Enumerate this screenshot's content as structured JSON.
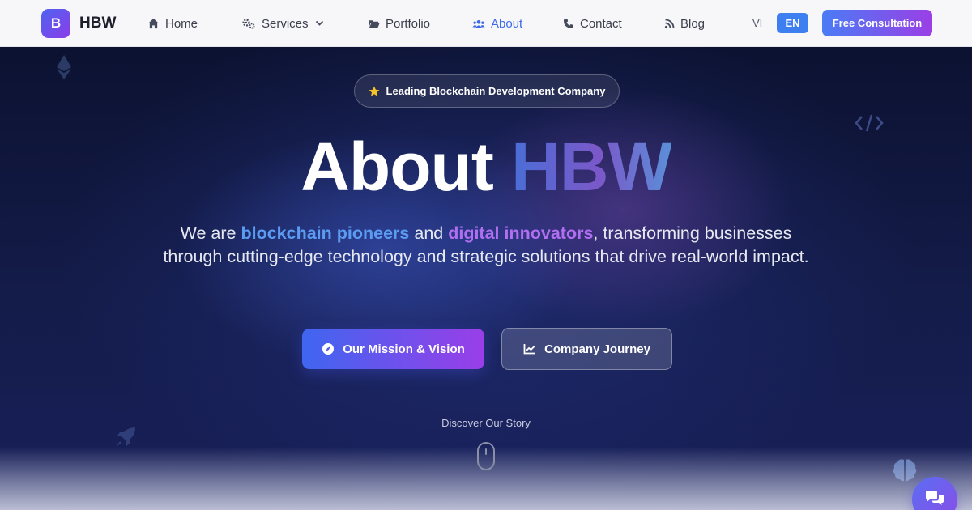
{
  "brand": {
    "logo_letter": "B",
    "name": "HBW"
  },
  "nav": {
    "items": [
      {
        "label": "Home",
        "icon": "home-icon"
      },
      {
        "label": "Services",
        "icon": "gears-icon",
        "has_dropdown": true
      },
      {
        "label": "Portfolio",
        "icon": "folder-icon"
      },
      {
        "label": "About",
        "icon": "users-icon",
        "active": true
      },
      {
        "label": "Contact",
        "icon": "phone-icon"
      },
      {
        "label": "Blog",
        "icon": "rss-icon"
      }
    ],
    "languages": {
      "vi": "VI",
      "en": "EN",
      "selected": "EN"
    },
    "cta_label": "Free Consultation"
  },
  "hero": {
    "badge": "Leading Blockchain Development Company",
    "title_plain": "About",
    "title_gradient": "HBW",
    "subtitle": {
      "part1": "We are ",
      "highlight1": "blockchain pioneers",
      "part2": " and ",
      "highlight2": "digital innovators",
      "part3": ", transforming businesses through cutting-edge technology and strategic solutions that drive real-world impact."
    },
    "primary_button": "Our Mission & Vision",
    "secondary_button": "Company Journey",
    "discover_label": "Discover Our Story"
  },
  "colors": {
    "accent_blue": "#3d68e8",
    "gradient_start": "#4a7cf5",
    "gradient_end": "#9a3fe6",
    "hero_bg": "#141c4a",
    "highlight_blue": "#5b9cf2",
    "highlight_purple": "#b06ef0"
  },
  "decorations": [
    "ethereum-icon",
    "code-icon",
    "rocket-icon",
    "brain-icon"
  ],
  "chat_widget": {
    "icon": "chat-icon"
  }
}
